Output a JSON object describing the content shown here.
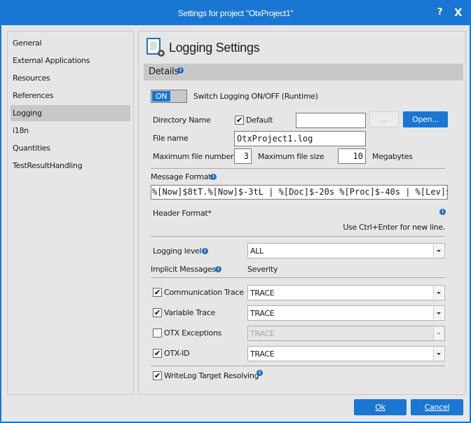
{
  "window": {
    "title": "Settings for project \"OtxProject1\"",
    "help": "?",
    "close": "X"
  },
  "sidebar": {
    "items": [
      {
        "label": "General"
      },
      {
        "label": "External Applications"
      },
      {
        "label": "Resources"
      },
      {
        "label": "References"
      },
      {
        "label": "Logging",
        "selected": true
      },
      {
        "label": "i18n"
      },
      {
        "label": "Quantities"
      },
      {
        "label": "TestResultHandling"
      }
    ]
  },
  "main": {
    "title": "Logging Settings",
    "section": "Details",
    "toggle": {
      "state": "ON",
      "label": "Switch Logging ON/OFF (Runtime)"
    },
    "directory": {
      "label": "Directory Name",
      "default_label": "Default",
      "default_checked": true,
      "value": "",
      "browse": "...",
      "open": "Open..."
    },
    "file_name": {
      "label": "File name",
      "value": "OtxProject1.log"
    },
    "max_file_number": {
      "label": "Maximum file number",
      "value": "3"
    },
    "max_file_size": {
      "label": "Maximum file size",
      "value": "10",
      "unit": "Megabytes"
    },
    "message_format": {
      "label": "Message Format",
      "value": "%[Now]$8tT.%[Now]$-3tL | %[Doc]$-20s %[Proc]$-40s | %[Lev]$-"
    },
    "header_format": {
      "label": "Header Format*",
      "hint": "Use Ctrl+Enter for new line."
    },
    "logging_level": {
      "label": "Logging level",
      "value": "ALL"
    },
    "implicit": {
      "label": "Implicit Messages",
      "severity_label": "Severity",
      "rows": [
        {
          "label": "Communication Trace",
          "checked": true,
          "value": "TRACE",
          "enabled": true
        },
        {
          "label": "Variable Trace",
          "checked": true,
          "value": "TRACE",
          "enabled": true
        },
        {
          "label": "OTX Exceptions",
          "checked": false,
          "value": "TRACE",
          "enabled": false
        },
        {
          "label": "OTX-ID",
          "checked": true,
          "value": "TRACE",
          "enabled": true
        }
      ]
    },
    "writelog": {
      "label": "WriteLog Target Resolving",
      "checked": true
    }
  },
  "footer": {
    "ok": "Ok",
    "cancel": "Cancel"
  },
  "colors": {
    "accent": "#1976d2"
  }
}
